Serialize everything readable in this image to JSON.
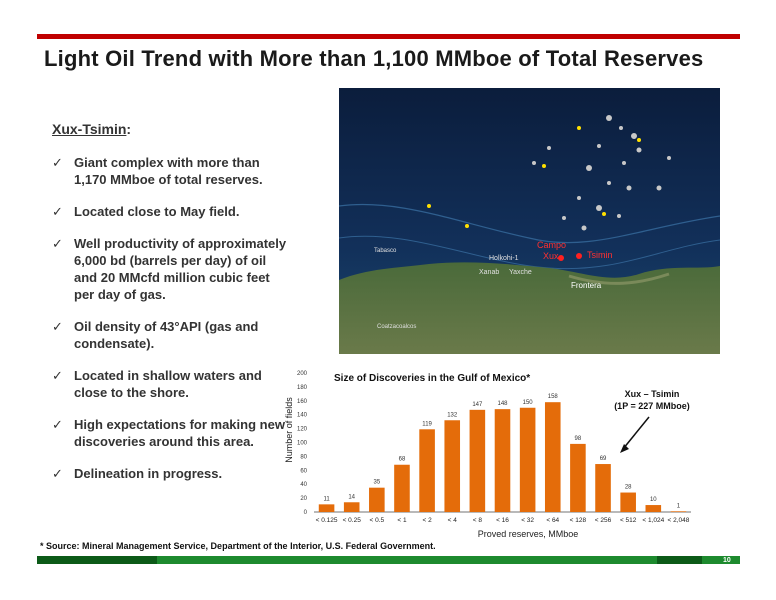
{
  "slide": {
    "title": "Light Oil Trend with More than 1,100 MMboe of Total Reserves",
    "subhead": "Xux-Tsimin",
    "subhead_colon": ":",
    "bullets": [
      "Giant complex with more than 1,170 MMboe of total reserves.",
      "Located close to May field.",
      "Well productivity of approximately 6,000 bd (barrels per day) of oil and 20 MMcfd million cubic feet per day of gas.",
      "Oil density of 43°API (gas and condensate).",
      "Located in shallow waters and close to the shore.",
      "High expectations for making new discoveries around this area.",
      "Delineation in progress."
    ],
    "check_glyph": "✓",
    "footnote": "* Source: Mineral Management Service, Department of the  Interior, U.S. Federal Government.",
    "page_number": "10"
  },
  "map": {
    "labels": {
      "campo": "Campo",
      "xux": "Xux",
      "tsimin": "Tsimin",
      "holkohi": "Holkohi-1",
      "xanab": "Xanab",
      "yaxche": "Yaxche",
      "frontera": "Frontera",
      "tabasco": "Tabasco",
      "coatzacoalcos": "Coatzacoalcos"
    }
  },
  "chart_data": {
    "type": "bar",
    "title": "Size of Discoveries in the Gulf of Mexico*",
    "xlabel": "Proved reserves, MMboe",
    "ylabel": "Number of fields",
    "categories": [
      "< 0.125",
      "< 0.25",
      "< 0.5",
      "< 1",
      "< 2",
      "< 4",
      "< 8",
      "< 16",
      "< 32",
      "< 64",
      "< 128",
      "< 256",
      "< 512",
      "< 1,024",
      "< 2,048"
    ],
    "values": [
      11,
      14,
      35,
      68,
      119,
      132,
      147,
      148,
      150,
      158,
      98,
      69,
      28,
      10,
      1
    ],
    "ylim": [
      0,
      200
    ],
    "yticks": [
      0,
      20,
      40,
      60,
      80,
      100,
      120,
      140,
      160,
      180,
      200
    ],
    "bar_color": "#e46c0a",
    "annotation": {
      "line1": "Xux – Tsimin",
      "line2": "(1P = 227 MMboe)"
    }
  }
}
